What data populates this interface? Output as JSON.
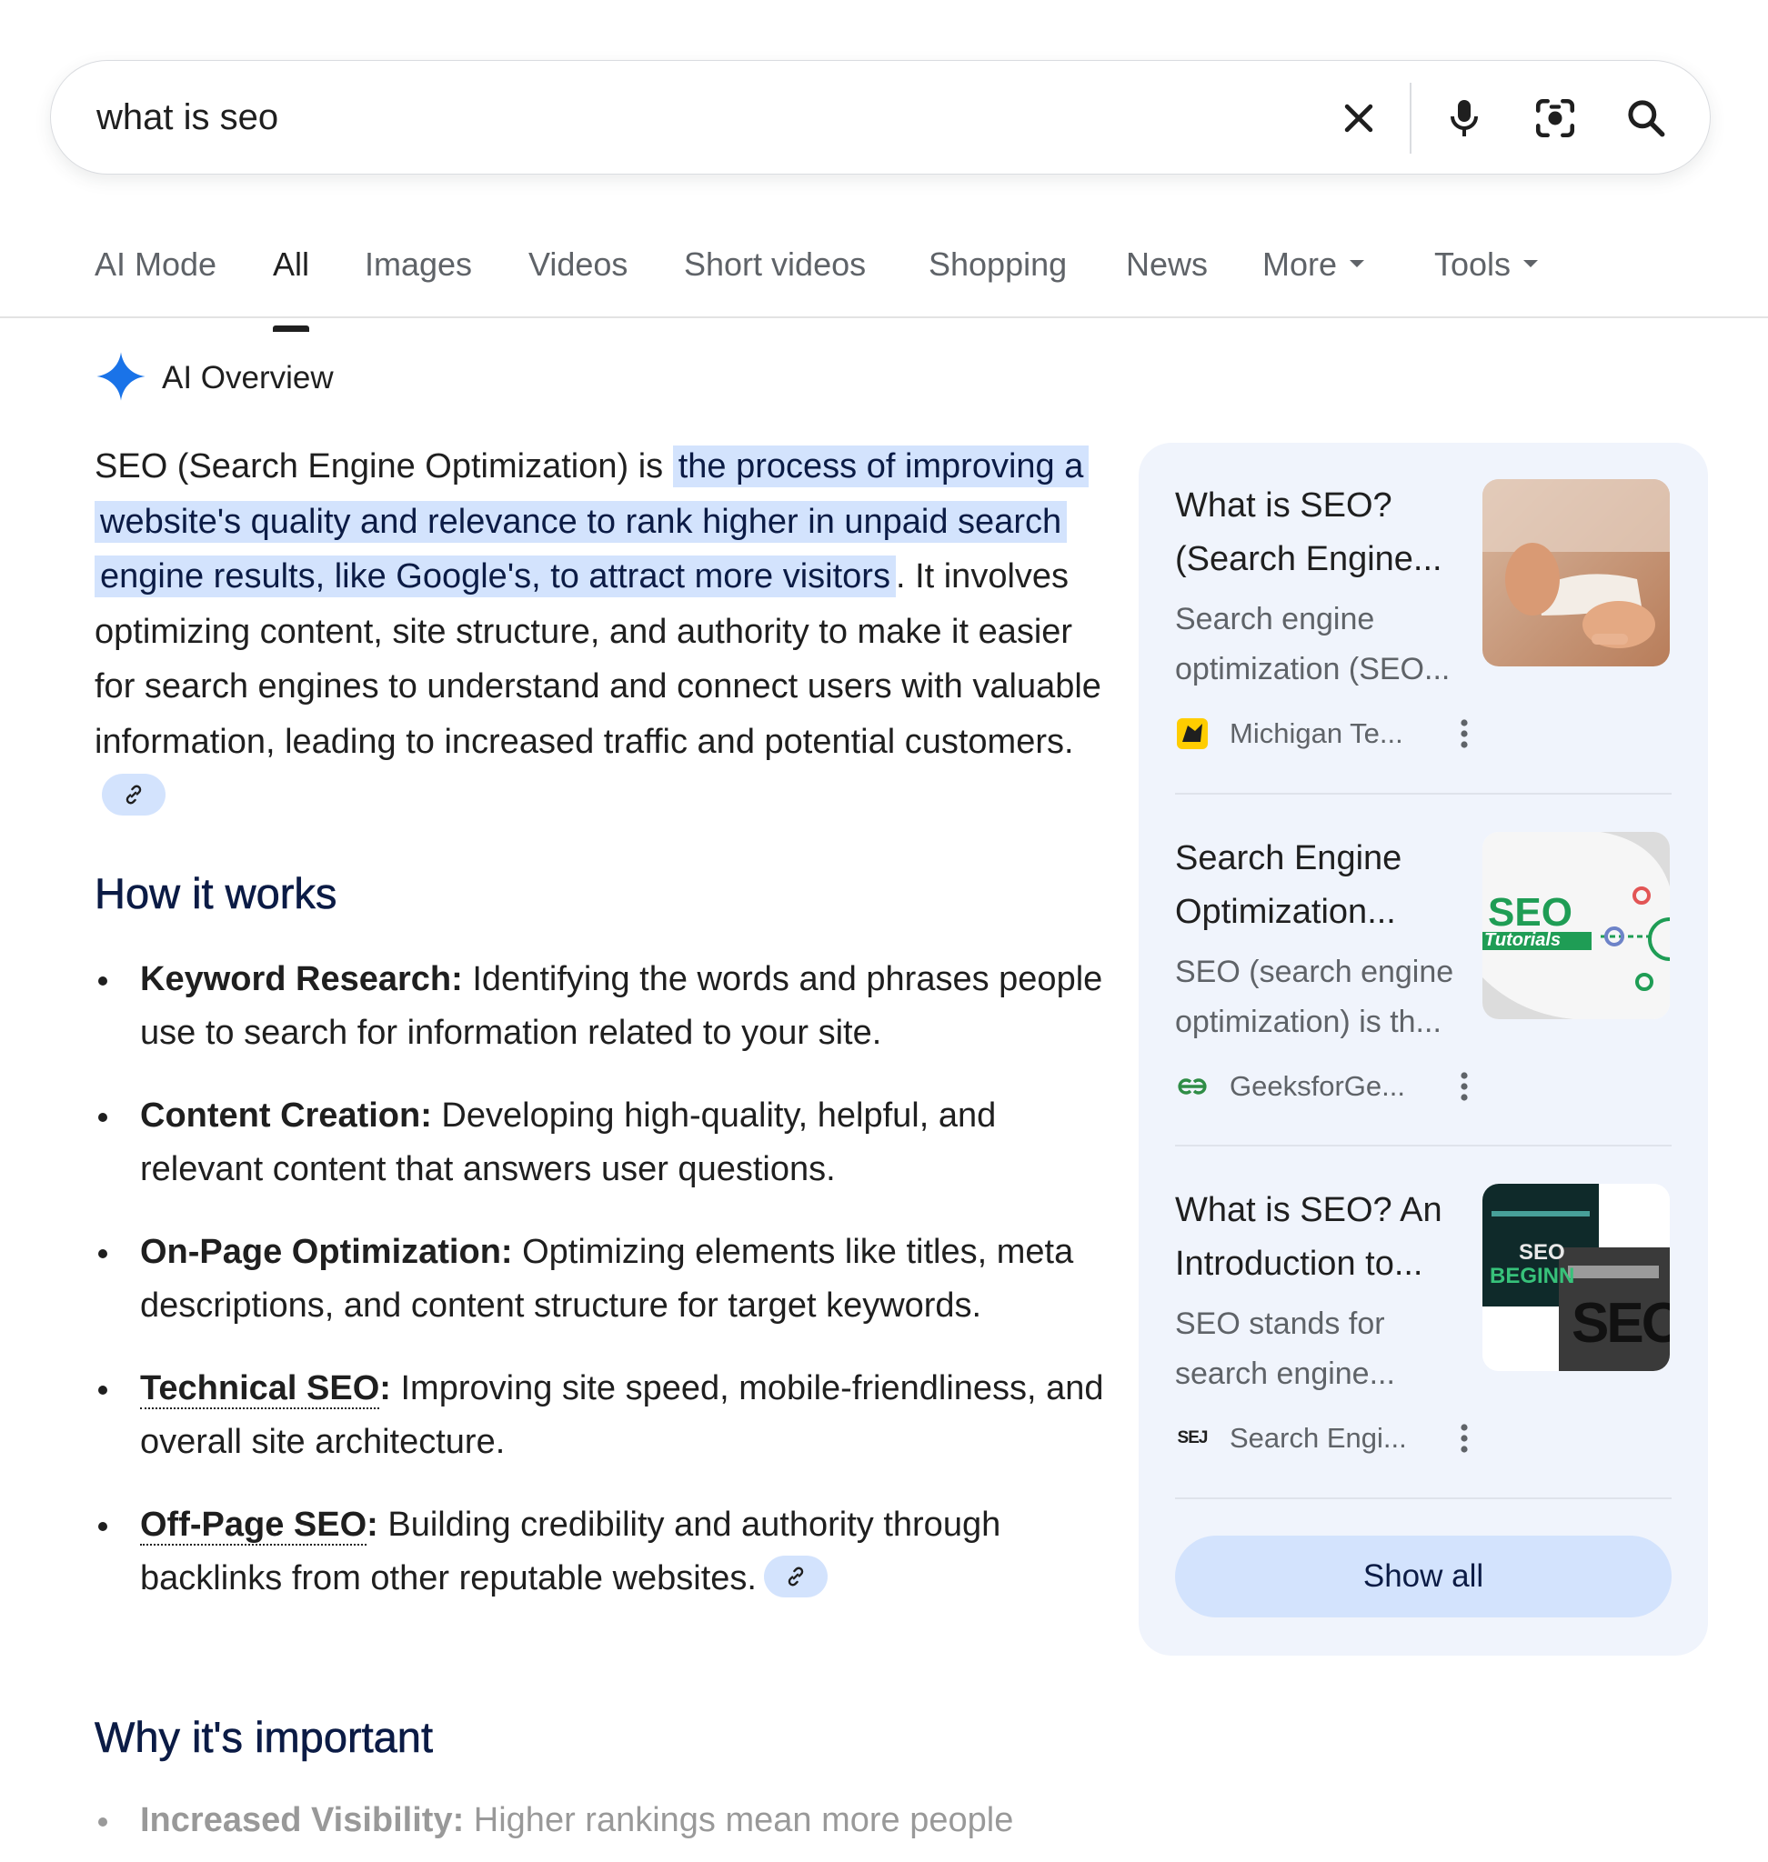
{
  "search": {
    "query": "what is seo",
    "icons": [
      "close-icon",
      "mic-icon",
      "lens-icon",
      "search-icon"
    ]
  },
  "tabs": [
    {
      "label": "AI Mode"
    },
    {
      "label": "All",
      "active": true
    },
    {
      "label": "Images"
    },
    {
      "label": "Videos"
    },
    {
      "label": "Short videos"
    },
    {
      "label": "Shopping"
    },
    {
      "label": "News"
    },
    {
      "label": "More",
      "dropdown": true
    },
    {
      "label": "Tools",
      "dropdown": true
    }
  ],
  "ai_overview": {
    "title": "AI Overview",
    "intro": {
      "lead": "SEO (Search Engine Optimization) is ",
      "highlight": "the process of improving a website's quality and relevance to rank higher in unpaid search engine results, like Google's, to attract more visitors",
      "rest": ". It involves optimizing content, site structure, and authority to make it easier for search engines to understand and connect users with valuable information, leading to increased traffic and potential customers."
    },
    "how_heading": "How it works",
    "how_items": [
      {
        "term": "Keyword Research:",
        "text": " Identifying the words and phrases people use to search for information related to your site."
      },
      {
        "term": "Content Creation:",
        "text": " Developing high-quality, helpful, and relevant content that answers user questions."
      },
      {
        "term": "On-Page Optimization:",
        "text": " Optimizing elements like titles, meta descriptions, and content structure for target keywords."
      },
      {
        "term": "Technical SEO",
        "colon": ":",
        "text": " Improving site speed, mobile-friendliness, and overall site architecture."
      },
      {
        "term": "Off-Page SEO",
        "colon": ":",
        "text": " Building credibility and authority through backlinks from other reputable websites."
      }
    ],
    "why_heading": "Why it's important",
    "why_items": [
      {
        "term": "Increased Visibility:",
        "text": " Higher rankings mean more people"
      }
    ]
  },
  "sources": {
    "cards": [
      {
        "title": "What is SEO? (Search Engine...",
        "snippet": "Search engine optimization (SEO...",
        "source": "Michigan Te...",
        "logo_icon": "husky-logo-icon",
        "thumb_icon": "phone-hands-icon"
      },
      {
        "title": "Search Engine Optimization...",
        "snippet": "SEO (search engine optimization) is th...",
        "source": "GeeksforGe...",
        "logo_icon": "gfg-logo-icon",
        "thumb_text": "SEO",
        "thumb_subtext": "Tutorials"
      },
      {
        "title": "What is SEO? An Introduction to...",
        "snippet": "SEO stands for search engine...",
        "source": "Search Engi...",
        "logo_text": "SEJ",
        "thumb_text_top": "SEO",
        "thumb_text_mid": "BEGINN",
        "thumb_text_big": "SEO"
      }
    ],
    "show_all_label": "Show all"
  },
  "colors": {
    "highlight": "#d3e3fd",
    "panel": "#f0f4fc",
    "heading": "#0b1b45",
    "muted": "#5f6368",
    "gemini_blue": "#1a73e8"
  }
}
